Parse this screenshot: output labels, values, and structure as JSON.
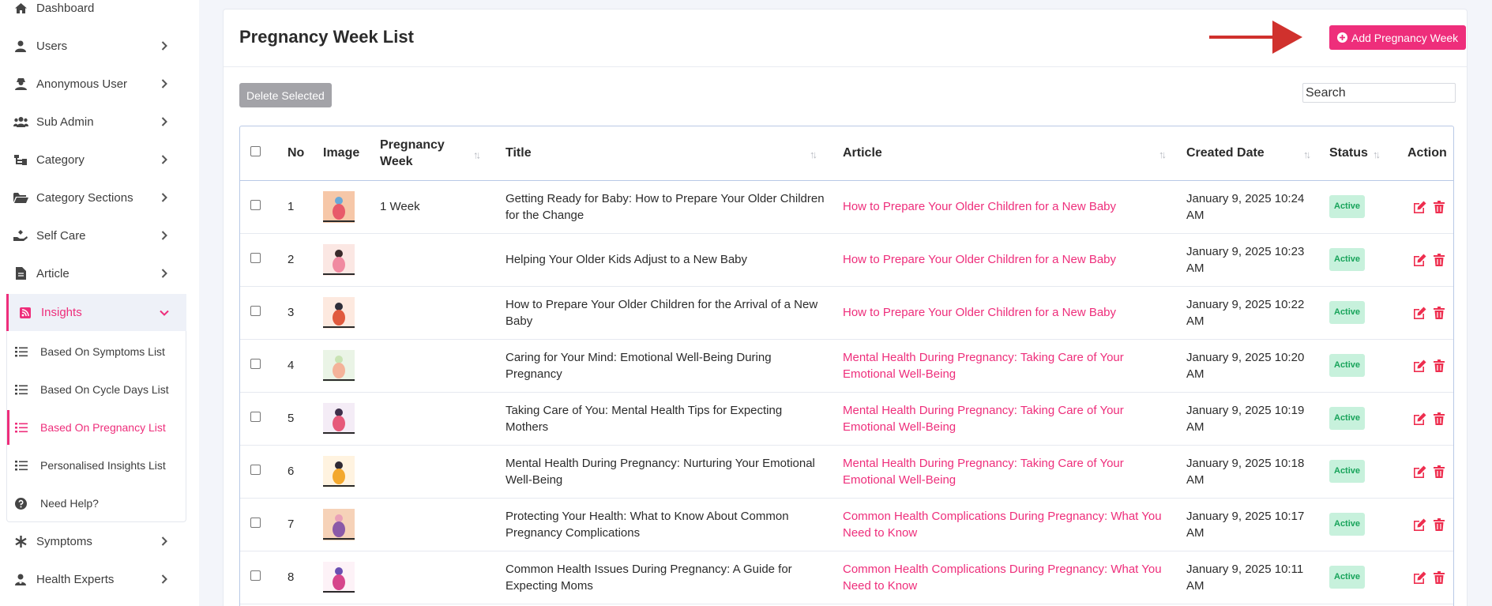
{
  "sidebar": {
    "items": [
      {
        "label": "Dashboard",
        "icon": "home-icon"
      },
      {
        "label": "Users",
        "icon": "user-icon"
      },
      {
        "label": "Anonymous User",
        "icon": "user-secret-icon"
      },
      {
        "label": "Sub Admin",
        "icon": "users-icon"
      },
      {
        "label": "Category",
        "icon": "sitemap-icon"
      },
      {
        "label": "Category Sections",
        "icon": "folder-open-icon"
      },
      {
        "label": "Self Care",
        "icon": "hand-holding-icon"
      },
      {
        "label": "Article",
        "icon": "file-icon"
      },
      {
        "label": "Insights",
        "icon": "rss-icon"
      },
      {
        "label": "Symptoms",
        "icon": "asterisk-icon"
      },
      {
        "label": "Health Experts",
        "icon": "user-doctor-icon"
      }
    ],
    "insights_sub": [
      {
        "label": "Based On Symptoms List",
        "icon": "list-icon"
      },
      {
        "label": "Based On Cycle Days List",
        "icon": "list-icon"
      },
      {
        "label": "Based On Pregnancy List",
        "icon": "list-icon"
      },
      {
        "label": "Personalised Insights List",
        "icon": "list-icon"
      },
      {
        "label": "Need Help?",
        "icon": "question-circle-icon"
      }
    ]
  },
  "header": {
    "title": "Pregnancy Week List",
    "add_button": "Add Pregnancy Week"
  },
  "toolbar": {
    "delete_button": "Delete Selected",
    "search_placeholder": "Search"
  },
  "table": {
    "columns": [
      "No",
      "Image",
      "Pregnancy Week",
      "Title",
      "Article",
      "Created Date",
      "Status",
      "Action"
    ],
    "rows": [
      {
        "no": "1",
        "week": "1 Week",
        "title": "Getting Ready for Baby: How to Prepare Your Older Children for the Change",
        "article": "How to Prepare Your Older Children for a New Baby",
        "date": "January 9, 2025 10:24 AM",
        "status": "Active"
      },
      {
        "no": "2",
        "week": "",
        "title": "Helping Your Older Kids Adjust to a New Baby",
        "article": "How to Prepare Your Older Children for a New Baby",
        "date": "January 9, 2025 10:23 AM",
        "status": "Active"
      },
      {
        "no": "3",
        "week": "",
        "title": "How to Prepare Your Older Children for the Arrival of a New Baby",
        "article": "How to Prepare Your Older Children for a New Baby",
        "date": "January 9, 2025 10:22 AM",
        "status": "Active"
      },
      {
        "no": "4",
        "week": "",
        "title": "Caring for Your Mind: Emotional Well-Being During Pregnancy",
        "article": "Mental Health During Pregnancy: Taking Care of Your Emotional Well-Being",
        "date": "January 9, 2025 10:20 AM",
        "status": "Active"
      },
      {
        "no": "5",
        "week": "",
        "title": "Taking Care of You: Mental Health Tips for Expecting Mothers",
        "article": "Mental Health During Pregnancy: Taking Care of Your Emotional Well-Being",
        "date": "January 9, 2025 10:19 AM",
        "status": "Active"
      },
      {
        "no": "6",
        "week": "",
        "title": "Mental Health During Pregnancy: Nurturing Your Emotional Well-Being",
        "article": "Mental Health During Pregnancy: Taking Care of Your Emotional Well-Being",
        "date": "January 9, 2025 10:18 AM",
        "status": "Active"
      },
      {
        "no": "7",
        "week": "",
        "title": "Protecting Your Health: What to Know About Common Pregnancy Complications",
        "article": "Common Health Complications During Pregnancy: What You Need to Know",
        "date": "January 9, 2025 10:17 AM",
        "status": "Active"
      },
      {
        "no": "8",
        "week": "",
        "title": "Common Health Issues During Pregnancy: A Guide for Expecting Moms",
        "article": "Common Health Complications During Pregnancy: What You Need to Know",
        "date": "January 9, 2025 10:11 AM",
        "status": "Active"
      }
    ]
  },
  "colors": {
    "accent": "#ee2e7b",
    "status_bg": "#c7f1dc",
    "status_text": "#17a35a",
    "arrow": "#d0312d"
  }
}
